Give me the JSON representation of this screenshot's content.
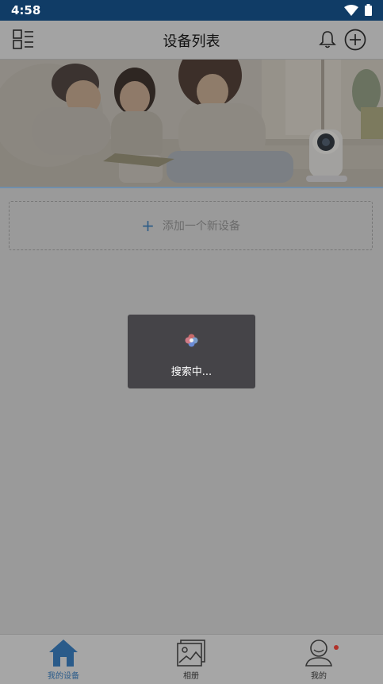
{
  "status_bar": {
    "time": "4:58"
  },
  "header": {
    "title": "设备列表"
  },
  "add_device": {
    "plus": "+",
    "label": "添加一个新设备"
  },
  "loading": {
    "text": "搜索中..."
  },
  "tabs": [
    {
      "label": "我的设备",
      "icon": "home-icon",
      "active": true
    },
    {
      "label": "相册",
      "icon": "album-icon",
      "active": false
    },
    {
      "label": "我的",
      "icon": "profile-icon",
      "active": false,
      "badge": true
    }
  ],
  "colors": {
    "status_bar": "#103c66",
    "accent": "#2a5b8a",
    "overlay_bg": "#9a9a9a",
    "badge": "#b1322a"
  }
}
